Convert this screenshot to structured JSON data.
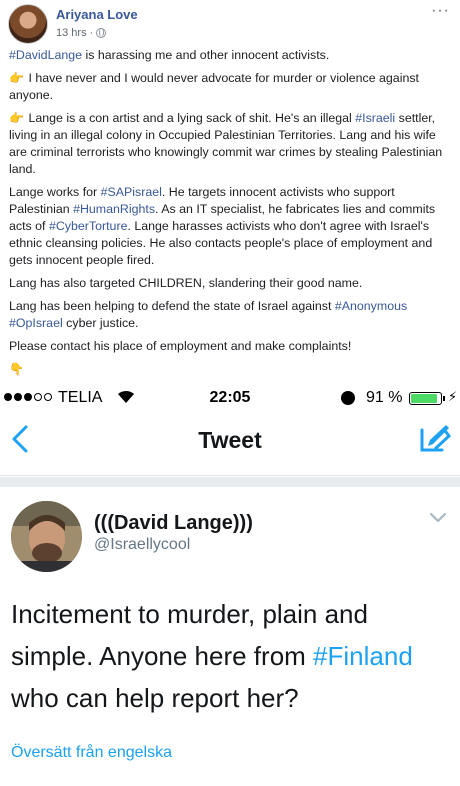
{
  "facebook_post": {
    "author": "Ariyana Love",
    "time": "13 hrs",
    "more_glyph": "···",
    "paragraphs": {
      "p1_tag": "#DavidLange",
      "p1_rest": " is harassing me and other innocent activists.",
      "p2": "I have never and I would never advocate for murder or violence against anyone.",
      "p3_a": "Lange is a con artist and a lying sack of shit. He's an illegal ",
      "p3_tag": "#Israeli",
      "p3_b": " settler, living in an illegal colony in Occupied Palestinian Territories. Lang and his wife are criminal terrorists who knowingly commit war crimes by stealing Palestinian land.",
      "p4_a": "Lange works for ",
      "p4_tag1": "#SAPisrael",
      "p4_b": ". He targets innocent activists who support Palestinian ",
      "p4_tag2": "#HumanRights",
      "p4_c": ". As an IT specialist, he fabricates lies and commits acts of ",
      "p4_tag3": "#CyberTorture",
      "p4_d": ". Lange harasses activists who don't agree with Israel's ethnic cleansing policies. He also contacts people's place of employment and gets innocent people fired.",
      "p5": "Lang has also targeted CHILDREN, slandering their good name.",
      "p6_a": "Lang has been helping to defend the state of Israel against ",
      "p6_tag1": "#Anonymous",
      "p6_b": " ",
      "p6_tag2": "#OpIsrael",
      "p6_c": " cyber justice.",
      "p7": "Please contact his place of employment and make complaints!"
    },
    "hand_glyph": "👉",
    "down_hand_glyph": "👇"
  },
  "ios_screenshot": {
    "status_bar": {
      "carrier": "TELIA",
      "time": "22:05",
      "battery": "91 %",
      "battery_level": 0.91,
      "bolt": "⚡"
    },
    "nav": {
      "title": "Tweet"
    },
    "tweet": {
      "display_name": "(((David Lange)))",
      "handle": "@Israellycool",
      "text_a": "Incitement to murder, plain and simple. Anyone here from ",
      "text_tag": "#Finland",
      "text_b": " who can help report her?",
      "translate_link": "Översätt från engelska"
    },
    "accent_color": "#1da1f2"
  }
}
